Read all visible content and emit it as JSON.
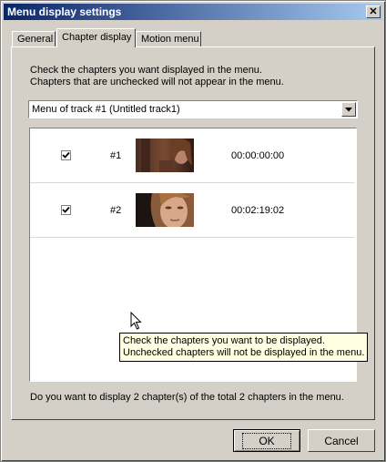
{
  "window": {
    "title": "Menu display settings",
    "close_glyph": "✕"
  },
  "tabs": [
    {
      "label": "General",
      "active": false
    },
    {
      "label": "Chapter display",
      "active": true
    },
    {
      "label": "Motion menu",
      "active": false
    }
  ],
  "panel": {
    "description_line1": "Check the chapters you want displayed in the menu.",
    "description_line2": "Chapters that are unchecked will not appear in the menu.",
    "track_select": {
      "value": "Menu of track #1 (Untitled track1)",
      "arrow_icon": "chevron-down-icon"
    },
    "chapters": [
      {
        "checked": true,
        "number": "#1",
        "time": "00:00:00:00"
      },
      {
        "checked": true,
        "number": "#2",
        "time": "00:02:19:02"
      }
    ],
    "tooltip_line1": "Check the chapters you want to be displayed.",
    "tooltip_line2": "Unchecked chapters will not be displayed in the menu.",
    "summary": "Do you want to display 2 chapter(s) of the total 2 chapters in the menu."
  },
  "buttons": {
    "ok": "OK",
    "cancel": "Cancel"
  },
  "colors": {
    "title_gradient_start": "#0a246a",
    "title_gradient_end": "#a6caf0",
    "face": "#d4d0c8",
    "tooltip_bg": "#ffffe1"
  }
}
